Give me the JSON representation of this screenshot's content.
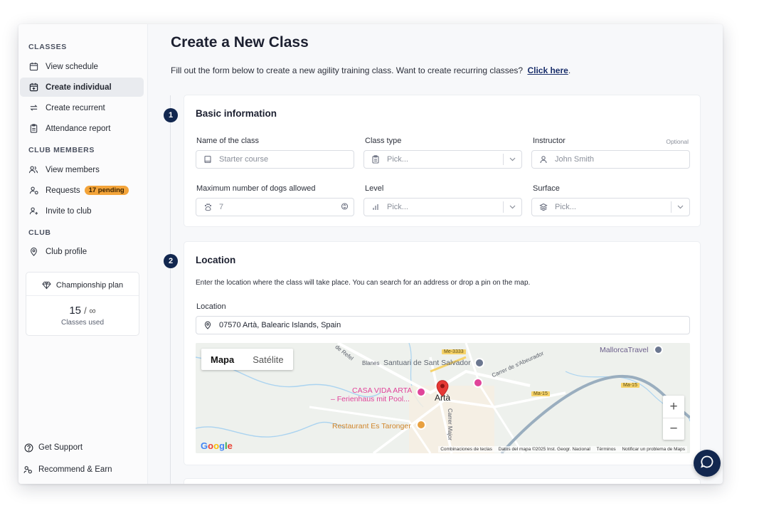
{
  "sidebar": {
    "sections": {
      "classes": "CLASSES",
      "members": "CLUB MEMBERS",
      "club": "CLUB"
    },
    "items": {
      "view_schedule": "View schedule",
      "create_individual": "Create individual",
      "create_recurrent": "Create recurrent",
      "attendance_report": "Attendance report",
      "view_members": "View members",
      "requests": "Requests",
      "requests_badge": "17 pending",
      "invite": "Invite to club",
      "club_profile": "Club profile"
    },
    "plan": {
      "name": "Championship plan",
      "used": "15",
      "limit": "/ ∞",
      "caption": "Classes used"
    },
    "footer": {
      "support": "Get Support",
      "recommend": "Recommend & Earn"
    }
  },
  "header": {
    "title": "Create a New Class",
    "description": "Fill out the form below to create a new agility training class. Want to create recurring classes?",
    "link": "Click here",
    "link_suffix": "."
  },
  "basic": {
    "step": "1",
    "title": "Basic information",
    "name_label": "Name of the class",
    "name_placeholder": "Starter course",
    "type_label": "Class type",
    "type_placeholder": "Pick...",
    "instructor_label": "Instructor",
    "instructor_optional": "Optional",
    "instructor_placeholder": "John Smith",
    "max_dogs_label": "Maximum number of dogs allowed",
    "max_dogs_value": "7",
    "level_label": "Level",
    "level_placeholder": "Pick...",
    "surface_label": "Surface",
    "surface_placeholder": "Pick..."
  },
  "location": {
    "step": "2",
    "title": "Location",
    "description": "Enter the location where the class will take place. You can search for an address or drop a pin on the map.",
    "label": "Location",
    "value": "07570 Artà, Balearic Islands, Spain",
    "map": {
      "tab_map": "Mapa",
      "tab_satellite": "Satélite",
      "zoom_in": "+",
      "zoom_out": "−",
      "labels": {
        "mallorca_travel": "MallorcaTravel",
        "santuari": "Santuari de Sant Salvador",
        "blanes": "Blanes",
        "refel": "de Refel",
        "casa_vida_1": "CASA VIDA ARTA",
        "casa_vida_2": "– Ferienhaus mit Pool...",
        "arta": "Artà",
        "restaurant": "Restaurant Es Taronger",
        "carrer_abeurador": "Carrer de s'Abeurador",
        "carrer_major": "Carrer Major",
        "me3333": "Me-3333",
        "ma15a": "Ma-15",
        "ma15b": "Ma-15"
      },
      "attribution": {
        "shortcuts": "Combinaciones de teclas",
        "data": "Datos del mapa ©2025 Inst. Geogr. Nacional",
        "terms": "Términos",
        "report": "Notificar un problema de Maps"
      }
    }
  },
  "colors": {
    "accent": "#12274f",
    "badge": "#f3a43a",
    "map_pin": "#e53935",
    "poi_pink": "#e0449a",
    "poi_orange": "#e8a040"
  }
}
